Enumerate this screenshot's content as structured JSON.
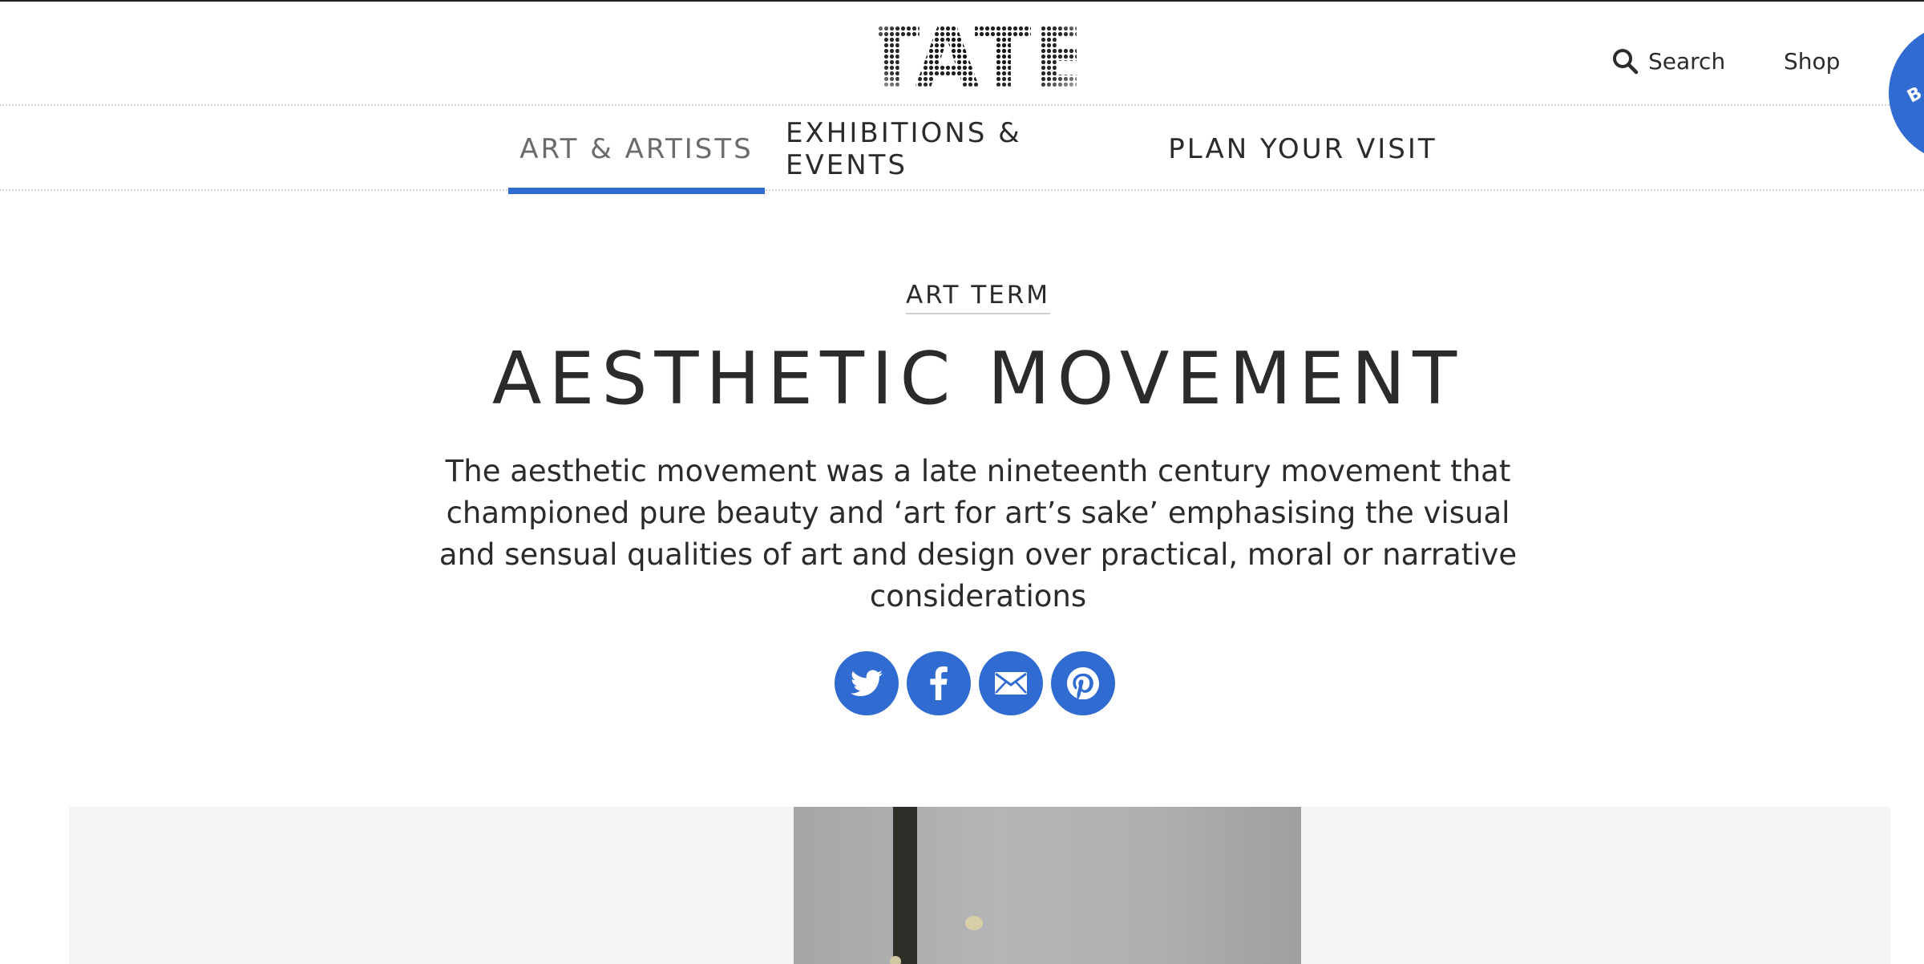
{
  "header": {
    "logo_text": "TATE",
    "search_label": "Search",
    "shop_label": "Shop",
    "badge_label": "B"
  },
  "nav": {
    "items": [
      {
        "label": "ART & ARTISTS",
        "active": true
      },
      {
        "label": "EXHIBITIONS & EVENTS",
        "active": false
      },
      {
        "label": "PLAN YOUR VISIT",
        "active": false
      }
    ]
  },
  "article": {
    "kicker": "ART TERM",
    "title": "AESTHETIC MOVEMENT",
    "intro": "The aesthetic movement was a late nineteenth century movement that championed pure beauty and ‘art for art’s sake’ emphasising the visual and sensual qualities of art and design over practical, moral or narrative considerations"
  },
  "share": {
    "icons": [
      "twitter-icon",
      "facebook-icon",
      "email-icon",
      "pinterest-icon"
    ]
  },
  "colors": {
    "accent": "#2f6bd0",
    "text": "#2b2b2b",
    "image_background": "#f6f5f3"
  }
}
